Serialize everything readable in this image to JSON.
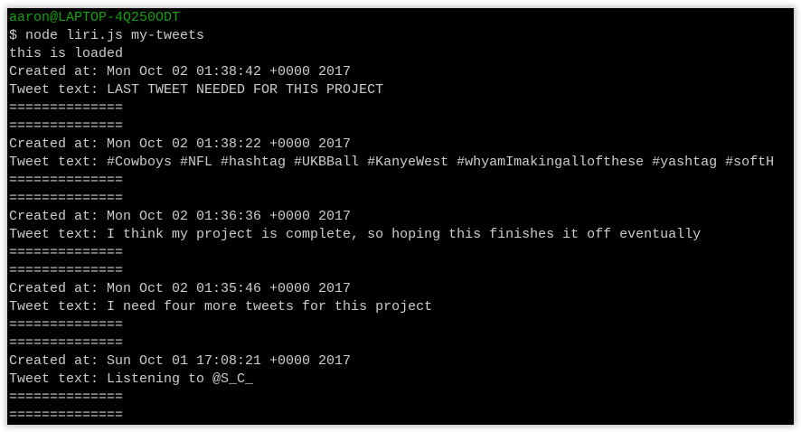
{
  "prompt": {
    "user_host": "aaron@LAPTOP-4Q250ODT",
    "command": "$ node liri.js my-tweets"
  },
  "loaded_message": "this is loaded",
  "separator": "==============",
  "tweets": [
    {
      "created": "Created at: Mon Oct 02 01:38:42 +0000 2017",
      "text": "Tweet text: LAST TWEET NEEDED FOR THIS PROJECT"
    },
    {
      "created": "Created at: Mon Oct 02 01:38:22 +0000 2017",
      "text": "Tweet text: #Cowboys #NFL #hashtag #UKBBall #KanyeWest #whyamImakingallofthese #yashtag #softH"
    },
    {
      "created": "Created at: Mon Oct 02 01:36:36 +0000 2017",
      "text": "Tweet text: I think my project is complete, so hoping this finishes it off eventually"
    },
    {
      "created": "Created at: Mon Oct 02 01:35:46 +0000 2017",
      "text": "Tweet text: I need four more tweets for this project"
    },
    {
      "created": "Created at: Sun Oct 01 17:08:21 +0000 2017",
      "text": "Tweet text: Listening to @S_C_"
    }
  ],
  "colors": {
    "background": "#000000",
    "text": "#cccccc",
    "prompt": "#13a10e"
  }
}
